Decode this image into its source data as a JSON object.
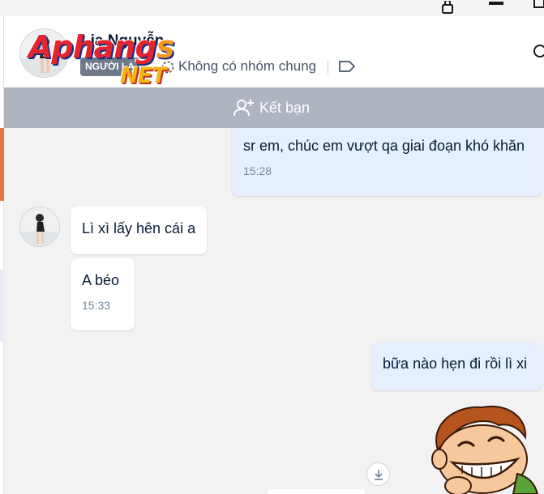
{
  "window": {
    "lock_icon": "lock-icon",
    "minimize_icon": "minimize-icon",
    "maximize_icon": "maximize-icon"
  },
  "header": {
    "contact_name": "Lia Nguyễn",
    "role_tag": "NGƯỜI LẠ",
    "no_common_group": "Không có nhóm chung",
    "group_icon": "group-icon",
    "tag_icon": "tag-icon",
    "search_icon": "search-icon"
  },
  "watermark": {
    "line1_main": "Aphang",
    "line1_accent": "s",
    "line2": "NET"
  },
  "add_friend": {
    "label": "Kết bạn",
    "icon": "add-user-icon"
  },
  "messages": [
    {
      "sender": "me",
      "text": "sr em, chúc em vượt qa giai đoạn khó khăn",
      "time": "15:28"
    },
    {
      "sender": "them",
      "text": "Lì xì lấy hên cái a",
      "time": ""
    },
    {
      "sender": "them",
      "text": "A béo",
      "time": "15:33"
    },
    {
      "sender": "me",
      "text": "bữa nào hẹn đi rồi lì xi",
      "time": ""
    }
  ],
  "download_icon": "download-icon",
  "sticker": "laughing-boy-sticker",
  "colors": {
    "my_bubble": "#e5efff",
    "their_bubble": "#ffffff",
    "add_friend_bar": "#aeb5bf",
    "background": "#f2f2f2"
  }
}
